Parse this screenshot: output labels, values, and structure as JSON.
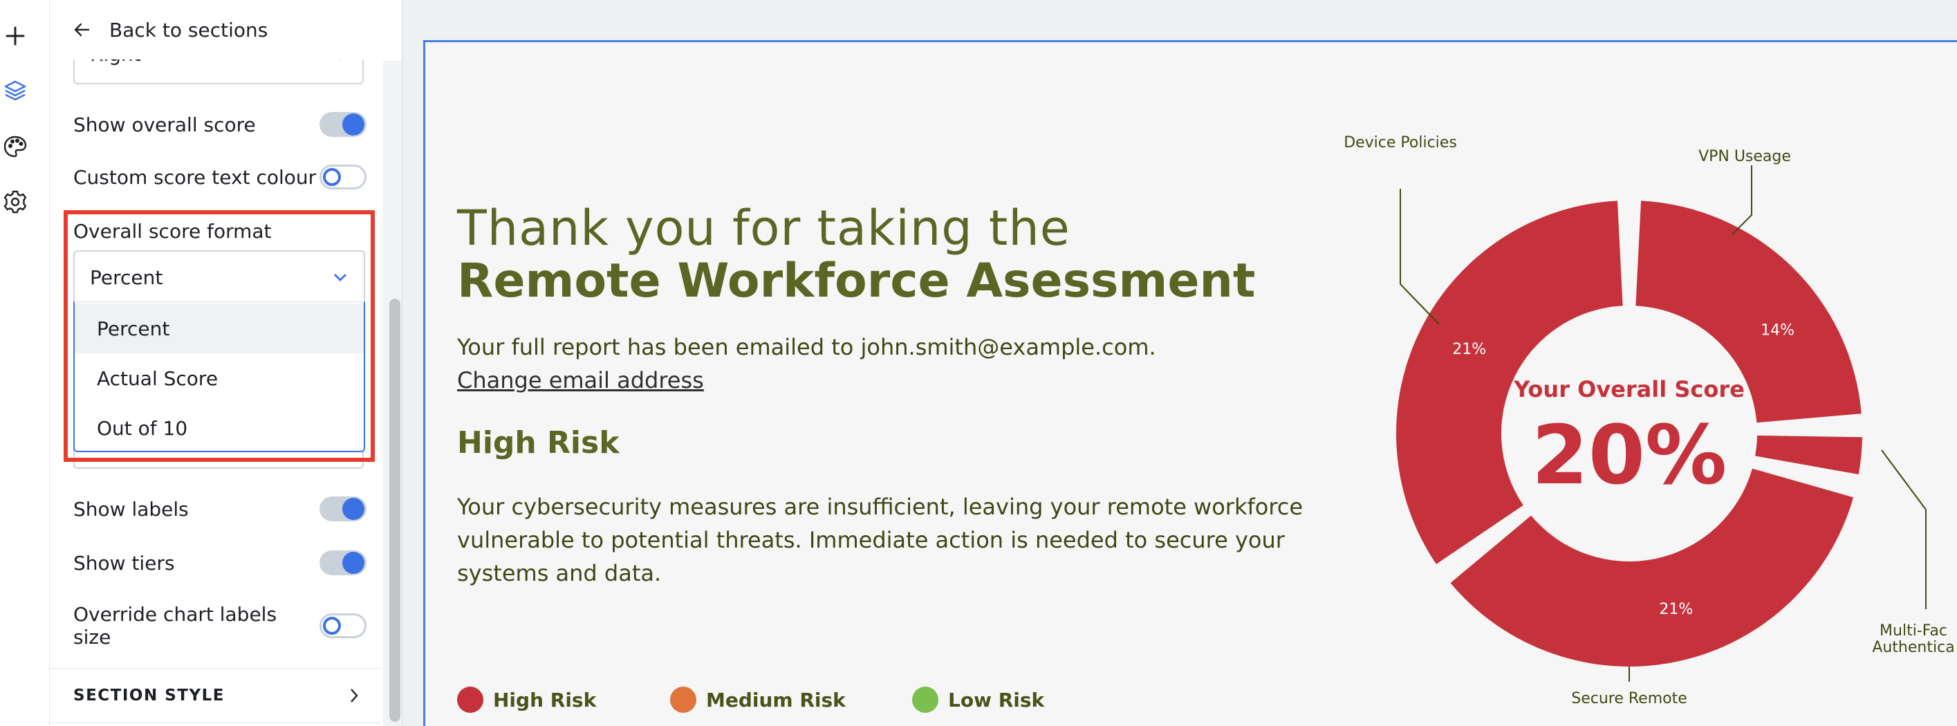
{
  "rail": {
    "icons": [
      "plus-icon",
      "layers-icon",
      "palette-icon",
      "gear-icon"
    ]
  },
  "panel": {
    "back_label": "Back to sections",
    "top_select_value": "Right",
    "show_overall_score": {
      "label": "Show overall score",
      "on": true
    },
    "custom_score_text_colour": {
      "label": "Custom score text colour",
      "on": false
    },
    "overall_score_format": {
      "label": "Overall score format",
      "value": "Percent",
      "options": [
        "Percent",
        "Actual Score",
        "Out of 10"
      ],
      "selected_option": "Percent"
    },
    "show_labels": {
      "label": "Show labels",
      "on": true
    },
    "show_tiers": {
      "label": "Show tiers",
      "on": true
    },
    "override_chart_labels_size": {
      "label": "Override chart labels size",
      "on": false
    },
    "section_style": "SECTION STYLE"
  },
  "result": {
    "title_line1": "Thank you for taking the",
    "title_line2": "Remote Workforce Asessment",
    "email_message": "Your full report has been emailed to john.smith@example.com.",
    "change_email": "Change email address",
    "risk_heading": "High Risk",
    "risk_description": "Your cybersecurity measures are insufficient, leaving your remote workforce vulnerable to potential threats. Immediate action is needed to secure your systems and data.",
    "legend": [
      {
        "label": "High Risk",
        "color": "#c6323b"
      },
      {
        "label": "Medium Risk",
        "color": "#e0743a"
      },
      {
        "label": "Low Risk",
        "color": "#7bbf4f"
      }
    ]
  },
  "chart_data": {
    "type": "pie",
    "variant": "donut",
    "center_title": "Your Overall Score",
    "center_value": "20%",
    "segment_color": "#c6323b",
    "segments": [
      {
        "label": "VPN Useage",
        "value": 14,
        "value_label": "14%"
      },
      {
        "label": "Multi-Factor Authentication",
        "value": 2,
        "value_label": "",
        "shown_label": "Multi-Fac\nAuthentica"
      },
      {
        "label": "Secure Remote",
        "value": 21,
        "value_label": "21%"
      },
      {
        "label": "Device Policies",
        "value": 21,
        "value_label": "21%"
      }
    ]
  }
}
